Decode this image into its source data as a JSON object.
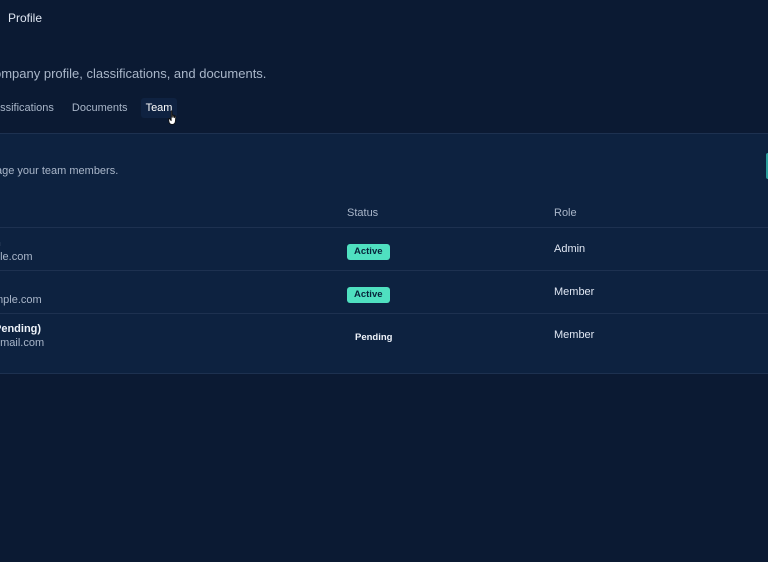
{
  "topbar": {
    "title": "Profile"
  },
  "header": {
    "subtitle": "ompany profile, classifications, and documents."
  },
  "tabs": [
    {
      "label": "assifications",
      "active": false
    },
    {
      "label": "Documents",
      "active": false
    },
    {
      "label": "Team",
      "active": true
    }
  ],
  "team": {
    "description": "age your team members.",
    "columns": {
      "status": "Status",
      "role": "Role"
    },
    "rows": [
      {
        "name": "n",
        "email": "ple.com",
        "status": "Active",
        "role": "Admin"
      },
      {
        "name": "",
        "email": "mple.com",
        "status": "Active",
        "role": "Member"
      },
      {
        "name": "Pending)",
        "email": "email.com",
        "status": "Pending",
        "role": "Member"
      }
    ]
  },
  "colors": {
    "background": "#0b1a33",
    "panel": "#0d2240",
    "active_badge": "#4fe0c0",
    "scroll_accent": "#2a9c9a"
  },
  "icons": {
    "cursor": "hand-pointer-icon"
  }
}
